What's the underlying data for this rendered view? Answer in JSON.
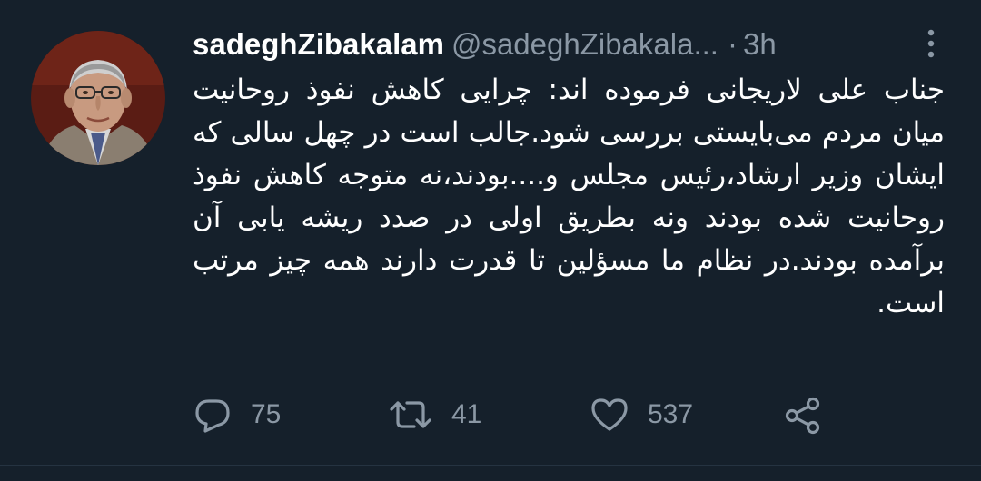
{
  "tweet": {
    "author": {
      "display_name": "sadeghZibakalam",
      "handle": "@sadeghZibakala...",
      "avatar_icon": "profile-photo"
    },
    "separator": "·",
    "timestamp": "3h",
    "text": "جناب علی لاریجانی فرموده اند: چرایی کاهش نفوذ روحانیت میان مردم می‌بایستی بررسی شود.جالب است در چهل سالی که ایشان وزیر ارشاد،رئیس مجلس و....بودند،نه متوجه کاهش نفوذ روحانیت شده بودند ونه بطریق اولی در صدد ریشه یابی آن برآمده بودند.در نظام ما مسؤلین تا قدرت دارند همه چیز مرتب است.",
    "actions": {
      "reply": {
        "icon": "reply-icon",
        "count": "75"
      },
      "retweet": {
        "icon": "retweet-icon",
        "count": "41"
      },
      "like": {
        "icon": "heart-icon",
        "count": "537"
      },
      "share": {
        "icon": "share-icon"
      }
    }
  },
  "colors": {
    "background": "#15202b",
    "primary_text": "#ffffff",
    "secondary_text": "#8b98a5"
  }
}
